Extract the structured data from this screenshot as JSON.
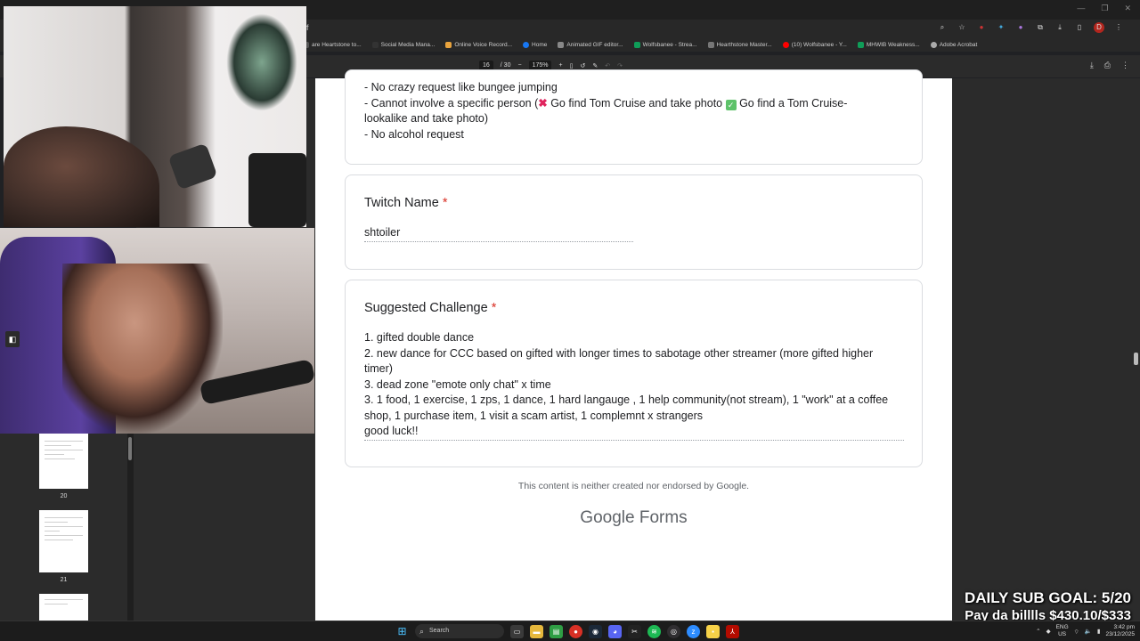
{
  "browser": {
    "url": "f",
    "bookmarks": [
      "are Heartstone to...",
      "Social Media Mana...",
      "Online Voice Record...",
      "Home",
      "Animated GIF editor...",
      "Wolfsbanee - Strea...",
      "Hearthstone Master...",
      "(10) Wolfsbanee - Y...",
      "MHWIB Weakness...",
      "Adobe Acrobat"
    ],
    "profile_initial": "D"
  },
  "pdf_toolbar": {
    "page_current": "16",
    "page_total": "/ 30",
    "zoom": "175%"
  },
  "thumbnails": [
    {
      "page": "20"
    },
    {
      "page": "21"
    }
  ],
  "form": {
    "rules_lines": {
      "l1": "- No crazy request like bungee jumping",
      "l2a": "- Cannot involve a specific person (",
      "l2b": " Go find Tom Cruise and take photo ",
      "l2c": " Go find a Tom Cruise-",
      "l3": "lookalike and take photo)",
      "l4": "- No alcohol request"
    },
    "twitch_question": "Twitch Name",
    "twitch_answer": "shtoiler",
    "challenge_question": "Suggested Challenge",
    "required_mark": "*",
    "challenge_lines": [
      "1. gifted double dance",
      "2. new dance for CCC based on gifted with longer times to sabotage other streamer (more gifted higher",
      "timer)",
      "3. dead zone \"emote only chat\" x time",
      "3.  1 food, 1 exercise, 1 zps, 1 dance, 1 hard langauge , 1 help community(not stream), 1 \"work\" at a coffee",
      "shop, 1 purchase item, 1 visit a scam artist, 1 complemnt x strangers",
      "good luck!!"
    ],
    "disclaimer": "This content is neither created nor endorsed by Google.",
    "brand_google": "Google",
    "brand_forms": "Forms"
  },
  "overlay": {
    "goal": "DAILY SUB GOAL: 5/20",
    "bills": "Pay da billlls $430.10/$333"
  },
  "taskbar": {
    "search_label": "Search",
    "lang_top": "ENG",
    "lang_bottom": "US",
    "time": "3:42 pm",
    "date": "23/12/2025"
  },
  "colors": {
    "required": "#d93025",
    "accent_check": "#5ec26a",
    "cross": "#e0245e"
  }
}
